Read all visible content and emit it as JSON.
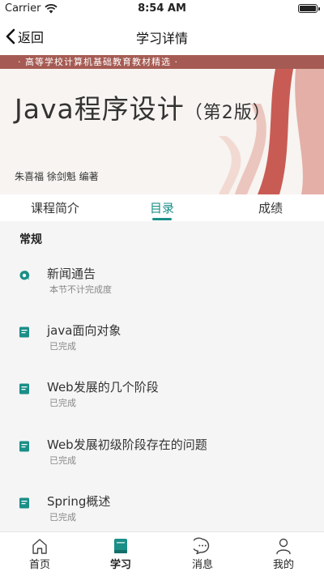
{
  "status_bar": {
    "carrier": "Carrier",
    "time": "8:54 AM"
  },
  "nav": {
    "back_label": "返回",
    "title": "学习详情"
  },
  "cover": {
    "banner": "· 高等学校计算机基础教育教材精选 ·",
    "title": "Java程序设计",
    "edition": "（第2版）",
    "authors": "朱喜福  徐剑魁  编著"
  },
  "tabs": [
    {
      "label": "课程简介"
    },
    {
      "label": "目录"
    },
    {
      "label": "成绩"
    }
  ],
  "active_tab": "目录",
  "section": {
    "title": "常规"
  },
  "lessons": [
    {
      "name": "新闻通告",
      "status": "本节不计完成度",
      "icon": "chat-bubble-icon"
    },
    {
      "name": "java面向对象",
      "status": "已完成",
      "icon": "document-icon"
    },
    {
      "name": "Web发展的几个阶段",
      "status": "已完成",
      "icon": "document-icon"
    },
    {
      "name": "Web发展初级阶段存在的问题",
      "status": "已完成",
      "icon": "document-icon"
    },
    {
      "name": "Spring概述",
      "status": "已完成",
      "icon": "document-icon"
    }
  ],
  "tab_bar": [
    {
      "label": "首页",
      "icon": "home-icon"
    },
    {
      "label": "学习",
      "icon": "book-icon"
    },
    {
      "label": "消息",
      "icon": "message-icon"
    },
    {
      "label": "我的",
      "icon": "user-icon"
    }
  ],
  "active_tab_bar": "学习",
  "colors": {
    "accent": "#1a8f87",
    "banner": "#a55b53",
    "stripe": "#c0413a"
  }
}
